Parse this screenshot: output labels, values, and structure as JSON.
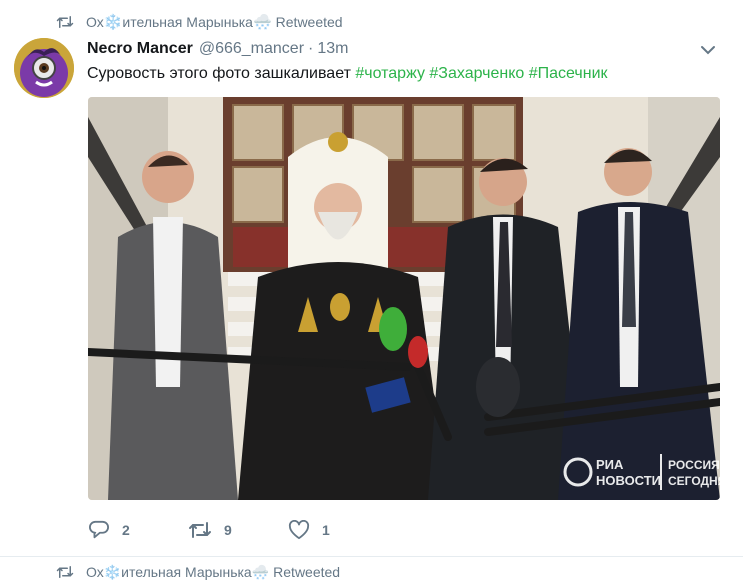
{
  "retweet_bar": {
    "name_before": "Ох",
    "emoji": "❄️",
    "name_after": "ительная Марынька",
    "cloud_emoji": "🌨️",
    "label": "Retweeted"
  },
  "tweet": {
    "fullname": "Necro Mancer",
    "username": "@666_mancer",
    "dot": "·",
    "time": "13m",
    "text_plain": "Суровость этого фото зашкаливает ",
    "hashtags": [
      "#чотаржу",
      "#Захарченко",
      "#Пасечник"
    ],
    "media_watermark": {
      "ria_line1": "РИА",
      "ria_line2": "НОВОСТИ",
      "russia_line1": "РОССИЯ",
      "russia_line2": "СЕГОДНЯ"
    },
    "actions": {
      "reply_count": "2",
      "retweet_count": "9",
      "like_count": "1"
    }
  },
  "next_tweet": {
    "name_before": "Ох",
    "emoji": "❄️",
    "name_after": "ительная Марынька",
    "cloud_emoji": "🌨️",
    "label": "Retweeted"
  },
  "colors": {
    "text": "#14171a",
    "muted": "#657786",
    "hashtag": "#2cb34a"
  },
  "icons": [
    "retweet-icon",
    "chevron-down-icon",
    "reply-icon",
    "like-icon"
  ]
}
